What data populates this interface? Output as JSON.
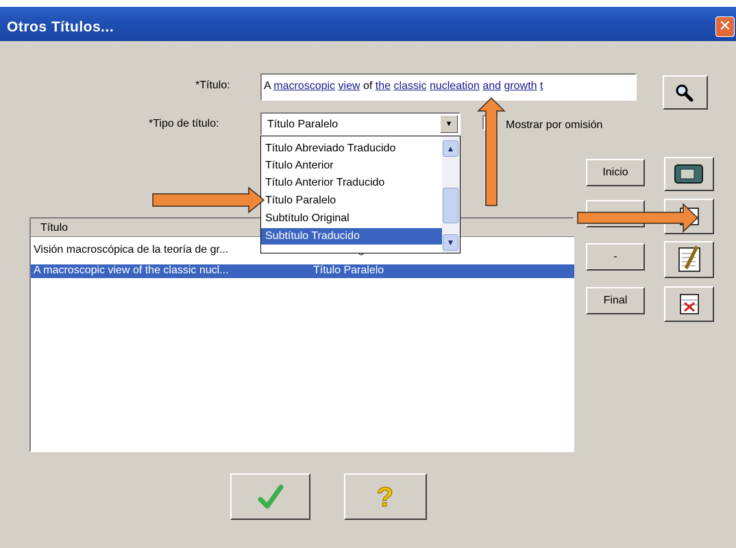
{
  "window": {
    "title": "Otros Títulos..."
  },
  "form": {
    "title_label": "*Título:",
    "title_value": "A macroscopic view of the classic nucleation and growth t",
    "type_label": "*Tipo de título:",
    "type_value": "Título Paralelo",
    "default_checkbox_label": "Mostrar por omisión",
    "default_checked": false
  },
  "dropdown": {
    "items": [
      "Título Abreviado Traducido",
      "Título Anterior",
      "Título Anterior Traducido",
      "Título Paralelo",
      "Subtítulo Original",
      "Subtítulo Traducido"
    ],
    "highlighted_index": 5
  },
  "nav_buttons": {
    "first": "Inicio",
    "prev": "",
    "next": "-",
    "last": "Final"
  },
  "list": {
    "header": "Título",
    "rows": [
      {
        "title": "Visión macroscópica  de la teoría de gr...",
        "type": "Título Original"
      },
      {
        "title": "A macroscopic view of the classic nucl...",
        "type": "Título Paralelo"
      }
    ],
    "selected_index": 1
  },
  "icons": {
    "search": "magnifier-icon",
    "clear": "eraser-icon",
    "insert": "insert-record-icon",
    "edit": "edit-pencil-icon",
    "delete": "delete-record-icon",
    "ok": "checkmark-icon",
    "help": "question-icon"
  },
  "colors": {
    "titlebar": "#1f4fb4",
    "selection": "#3a64c0",
    "annotation_arrow": "#f0883a"
  }
}
